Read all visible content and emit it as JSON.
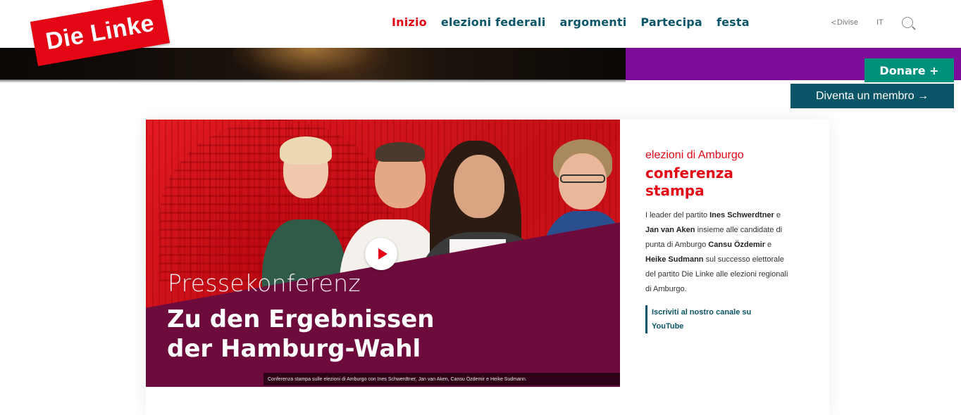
{
  "logo": {
    "text": "Die Linke"
  },
  "nav": {
    "items": [
      {
        "label": "Inizio",
        "active": true
      },
      {
        "label": "elezioni federali",
        "active": false
      },
      {
        "label": "argomenti",
        "active": false
      },
      {
        "label": "Partecipa",
        "active": false
      },
      {
        "label": "festa",
        "active": false
      }
    ]
  },
  "utility": {
    "share_label": "Divise",
    "language": "IT",
    "share_icon": "share-icon",
    "search_icon": "search-icon"
  },
  "cta": {
    "donate_label": "Donare +",
    "member_label": "Diventa un membro →"
  },
  "hero": {
    "kicker": "Pressekonferenz",
    "title_line1": "Zu den Ergebnissen",
    "title_line2": "der Hamburg-Wahl",
    "caption": "Conferenza stampa sulle elezioni di Amburgo con Ines Schwerdtner, Jan van Aken, Cansu Özdemir e Heike Sudmann.",
    "play_icon": "play-icon"
  },
  "article": {
    "kicker": "elezioni di Amburgo",
    "headline": "conferenza stampa",
    "body_1": "I leader del partito ",
    "body_name_1": "Ines Schwerdtner",
    "body_2": " e ",
    "body_name_2": "Jan van Aken",
    "body_3": " insieme alle candidate di punta di Amburgo ",
    "body_name_3": "Cansu Özdemir",
    "body_4": " e ",
    "body_name_4": "Heike Sudmann",
    "body_5": " sul successo elettorale del partito Die Linke alle elezioni regionali di Amburgo.",
    "youtube_link": "Iscriviti al nostro canale su YouTube"
  },
  "colors": {
    "brand_red": "#e40515",
    "teal": "#0a5668",
    "green": "#00917d",
    "purple": "#7c0d98",
    "overlay": "#6e0b3d"
  }
}
